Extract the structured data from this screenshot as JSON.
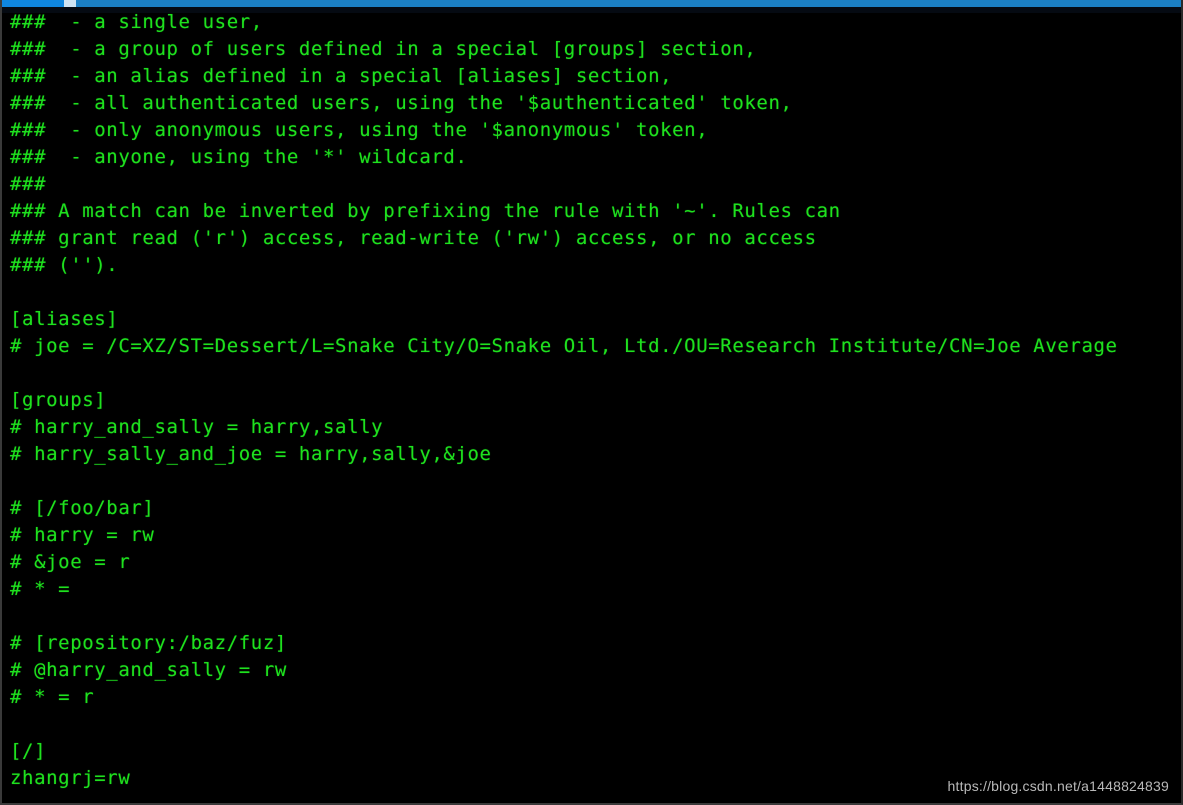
{
  "window": {
    "titlebar_color": "#1b7fc4",
    "titlebar_active_color": "#0f86e0",
    "titlebar_highlight_color": "#cfe3f2",
    "background_color": "#000000",
    "text_color": "#1ee11e"
  },
  "terminal": {
    "lines": [
      "###  - a single user,",
      "###  - a group of users defined in a special [groups] section,",
      "###  - an alias defined in a special [aliases] section,",
      "###  - all authenticated users, using the '$authenticated' token,",
      "###  - only anonymous users, using the '$anonymous' token,",
      "###  - anyone, using the '*' wildcard.",
      "###",
      "### A match can be inverted by prefixing the rule with '~'. Rules can",
      "### grant read ('r') access, read-write ('rw') access, or no access",
      "### ('').",
      "",
      "[aliases]",
      "# joe = /C=XZ/ST=Dessert/L=Snake City/O=Snake Oil, Ltd./OU=Research Institute/CN=Joe Average",
      "",
      "[groups]",
      "# harry_and_sally = harry,sally",
      "# harry_sally_and_joe = harry,sally,&joe",
      "",
      "# [/foo/bar]",
      "# harry = rw",
      "# &joe = r",
      "# * =",
      "",
      "# [repository:/baz/fuz]",
      "# @harry_and_sally = rw",
      "# * = r",
      "",
      "[/]",
      "zhangrj=rw"
    ]
  },
  "watermark": {
    "text": "https://blog.csdn.net/a1448824839"
  }
}
